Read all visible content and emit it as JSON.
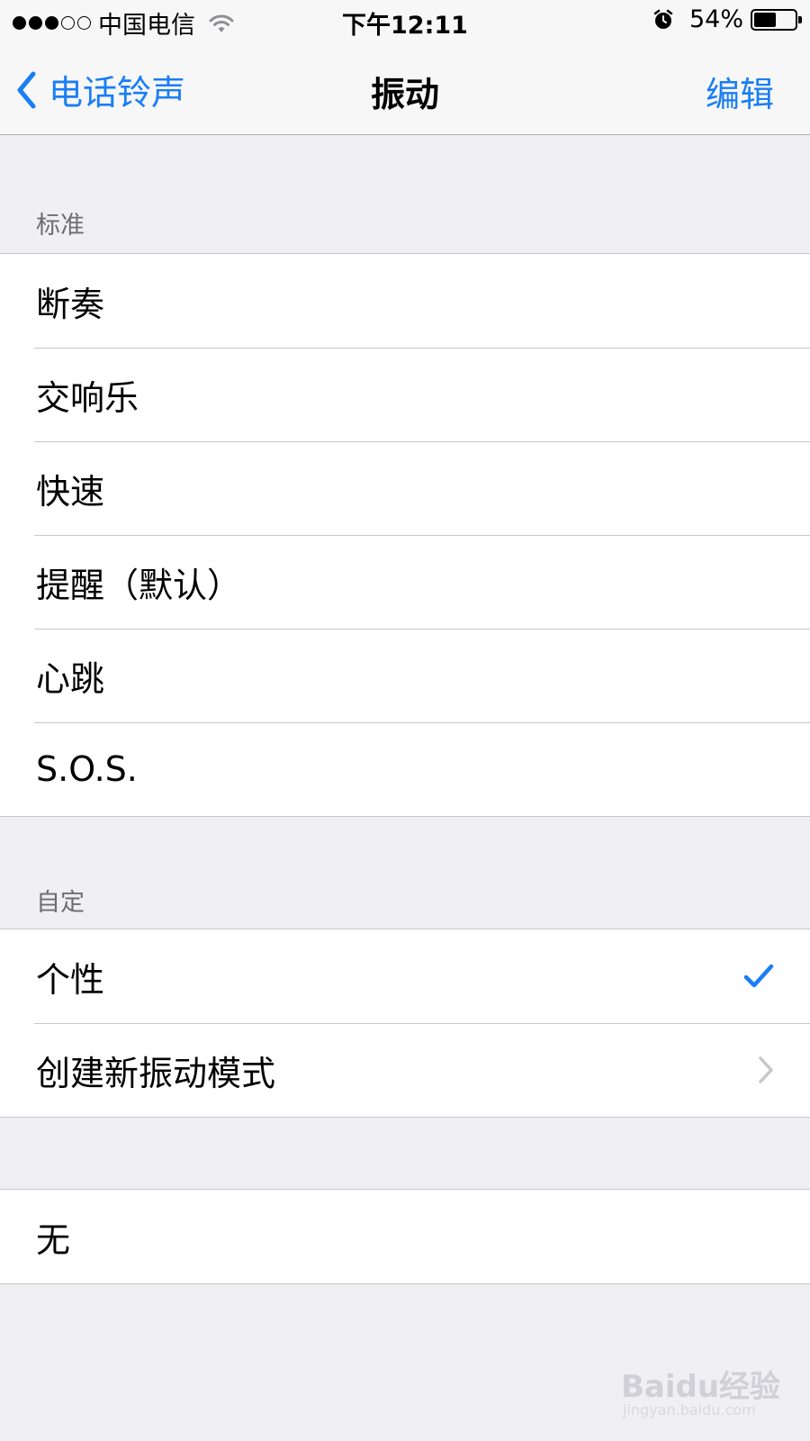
{
  "status_bar": {
    "carrier": "中国电信",
    "time": "下午12:11",
    "battery_percent": "54%",
    "battery_level": 0.54,
    "signal_bars": 3,
    "signal_total": 5,
    "icons": [
      "wifi-icon",
      "alarm-icon",
      "battery-icon"
    ]
  },
  "nav": {
    "back_label": "电话铃声",
    "title": "振动",
    "edit_label": "编辑"
  },
  "sections": {
    "standard": {
      "header": "标准",
      "items": [
        {
          "label": "断奏"
        },
        {
          "label": "交响乐"
        },
        {
          "label": "快速"
        },
        {
          "label": "提醒（默认）"
        },
        {
          "label": "心跳"
        },
        {
          "label": "S.O.S."
        }
      ]
    },
    "custom": {
      "header": "自定",
      "items": [
        {
          "label": "个性",
          "selected": true
        },
        {
          "label": "创建新振动模式",
          "accessory": "chevron-right-icon"
        }
      ]
    },
    "none": {
      "items": [
        {
          "label": "无"
        }
      ]
    }
  },
  "watermark": {
    "text": "Baidu经验",
    "sub": "jingyan.baidu.com"
  },
  "colors": {
    "accent": "#1a7ef5",
    "background": "#efeff4",
    "header_text": "#6d6d72"
  }
}
